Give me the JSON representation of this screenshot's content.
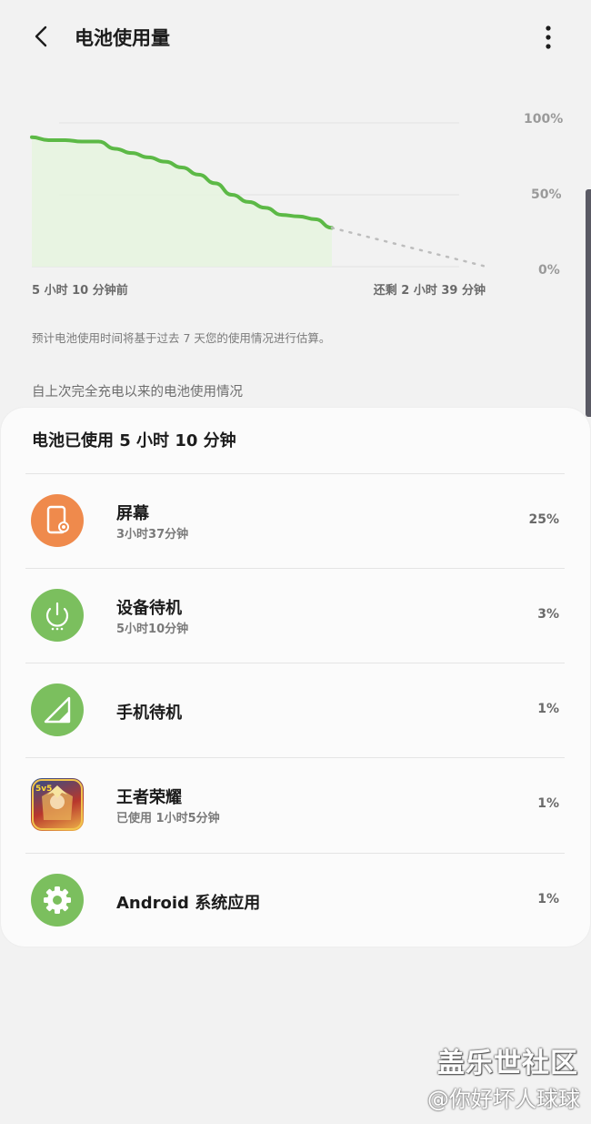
{
  "header": {
    "title": "电池使用量"
  },
  "chart": {
    "y_labels": [
      "100%",
      "50%",
      "0%"
    ],
    "start_label": "5 小时 10 分钟前",
    "end_label": "还剩 2 小时 39 分钟",
    "colors": {
      "line": "#5cb946",
      "fill": "#e6f4df",
      "projection": "#bdbdbd"
    }
  },
  "chart_data": {
    "type": "area",
    "ylim": [
      0,
      100
    ],
    "x_start_label": "5 小时 10 分钟前",
    "x_end_label": "还剩 2 小时 39 分钟",
    "series": [
      {
        "values": [
          90,
          88,
          88,
          87,
          87,
          82,
          79,
          76,
          73,
          69,
          64,
          58,
          50,
          45,
          41,
          36,
          35,
          33,
          27
        ]
      }
    ],
    "projection_end": 0
  },
  "note": "预计电池使用时间将基于过去 7 天您的使用情况进行估算。",
  "since_label": "自上次完全充电以来的电池使用情况",
  "card": {
    "title": "电池已使用 5 小时 10 分钟",
    "items": [
      {
        "name": "屏幕",
        "sub": "3小时37分钟",
        "percent": "25%",
        "icon": "screen-icon",
        "color": "#ef8a4c"
      },
      {
        "name": "设备待机",
        "sub": "5小时10分钟",
        "percent": "3%",
        "icon": "power-icon",
        "color": "#7bbf5e"
      },
      {
        "name": "手机待机",
        "sub": "",
        "percent": "1%",
        "icon": "signal-icon",
        "color": "#7bbf5e"
      },
      {
        "name": "王者荣耀",
        "sub": "已使用 1小时5分钟",
        "percent": "1%",
        "icon": "game-app-icon",
        "color": "#c0392b"
      },
      {
        "name": "Android 系统应用",
        "sub": "",
        "percent": "1%",
        "icon": "gear-icon",
        "color": "#7bbf5e"
      }
    ]
  },
  "watermark": {
    "line1": "盖乐世社区",
    "line2": "@你好坏人球球"
  }
}
